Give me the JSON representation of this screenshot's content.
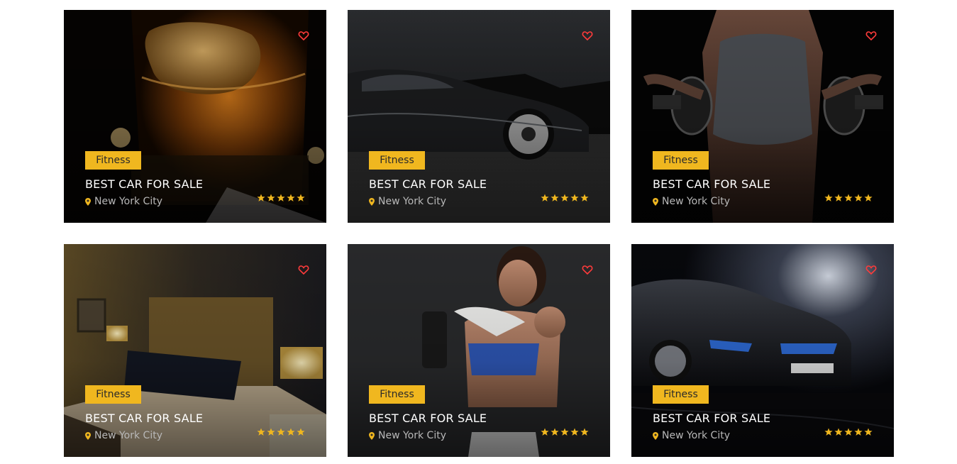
{
  "colors": {
    "badge": "#f0b71f",
    "heart": "#ff3b3b",
    "star": "#f0b71f",
    "title": "#ffffff",
    "location": "#b8b8b8"
  },
  "cards": [
    {
      "badge": "Fitness",
      "title": "BEST CAR FOR SALE",
      "location": "New York City",
      "rating": 5,
      "image": "whiskey-glass"
    },
    {
      "badge": "Fitness",
      "title": "BEST CAR FOR SALE",
      "location": "New York City",
      "rating": 5,
      "image": "black-sports-car"
    },
    {
      "badge": "Fitness",
      "title": "BEST CAR FOR SALE",
      "location": "New York City",
      "rating": 5,
      "image": "woman-dumbbells"
    },
    {
      "badge": "Fitness",
      "title": "BEST CAR FOR SALE",
      "location": "New York City",
      "rating": 5,
      "image": "hotel-bedroom"
    },
    {
      "badge": "Fitness",
      "title": "BEST CAR FOR SALE",
      "location": "New York City",
      "rating": 5,
      "image": "woman-thumbs-up"
    },
    {
      "badge": "Fitness",
      "title": "BEST CAR FOR SALE",
      "location": "New York City",
      "rating": 5,
      "image": "bmw-i8"
    }
  ]
}
